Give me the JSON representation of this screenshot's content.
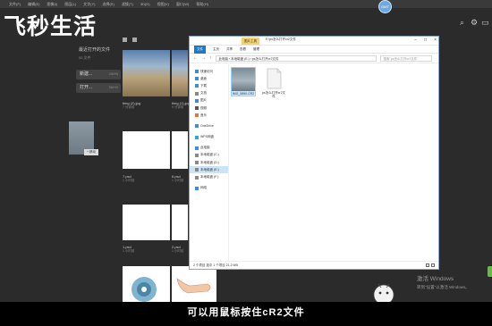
{
  "menubar": {
    "items": [
      "文件(F)",
      "编辑(E)",
      "图像(I)",
      "图层(L)",
      "文字(Y)",
      "选择(S)",
      "滤镜(T)",
      "3D(D)",
      "视图(V)",
      "窗口(W)",
      "帮助(H)"
    ]
  },
  "watermark": {
    "logo_text": "飞秒生活"
  },
  "avatar_text": "GMT",
  "home": {
    "recent_title": "最近打开的文件",
    "recent_sub": "00 文件",
    "new_label": "新建...",
    "new_shortcut": "Ctrl+N",
    "open_label": "打开...",
    "open_shortcut": "Ctrl+O",
    "files": [
      {
        "name": "timg (2).jpg",
        "sub": "7 分钟前"
      },
      {
        "name": "timg (1).jpg",
        "sub": "9 分钟前"
      },
      {
        "name": "7.psd",
        "sub": "1 小时前"
      },
      {
        "name": "6.psd",
        "sub": "1 小时前"
      },
      {
        "name": "1.psd",
        "sub": "1 小时前"
      },
      {
        "name": "2.psd",
        "sub": "1 小时前"
      }
    ],
    "drag_badge": "+ 移动"
  },
  "explorer": {
    "tools_tab": "图片工具",
    "title_path": "E:\\ps怎么打开cr2文件",
    "ribbon": [
      "文件",
      "主页",
      "共享",
      "查看",
      "管理"
    ],
    "address": "此电脑 › 本地磁盘 (E:) › ps怎么打开cr2文件",
    "search_placeholder": "搜索\"ps怎么打开cr2文件\"",
    "nav": [
      {
        "label": "快速访问",
        "hdr": true
      },
      {
        "label": "桌面"
      },
      {
        "label": "下载"
      },
      {
        "label": "文档"
      },
      {
        "label": "图片"
      },
      {
        "label": "视频"
      },
      {
        "label": "音乐"
      },
      {
        "label": "OneDrive",
        "hdr": true
      },
      {
        "label": "WPS网盘",
        "hdr": true
      },
      {
        "label": "此电脑",
        "hdr": true
      },
      {
        "label": "本地磁盘 (C:)"
      },
      {
        "label": "本地磁盘 (D:)"
      },
      {
        "label": "本地磁盘 (E:)",
        "sel": true
      },
      {
        "label": "本地磁盘 (F:)"
      },
      {
        "label": "网络",
        "hdr": true
      }
    ],
    "files": [
      {
        "name": "IMG_5890.CR2"
      },
      {
        "name": "ps怎么打开cr2文件"
      }
    ],
    "status": "2 个项目   选中 1 个项目 21.2 MB"
  },
  "activation": {
    "line1": "激活 Windows",
    "line2": "转到\"设置\"以激活 Windows。"
  },
  "subtitle": "可以用鼠标按住cR2文件"
}
